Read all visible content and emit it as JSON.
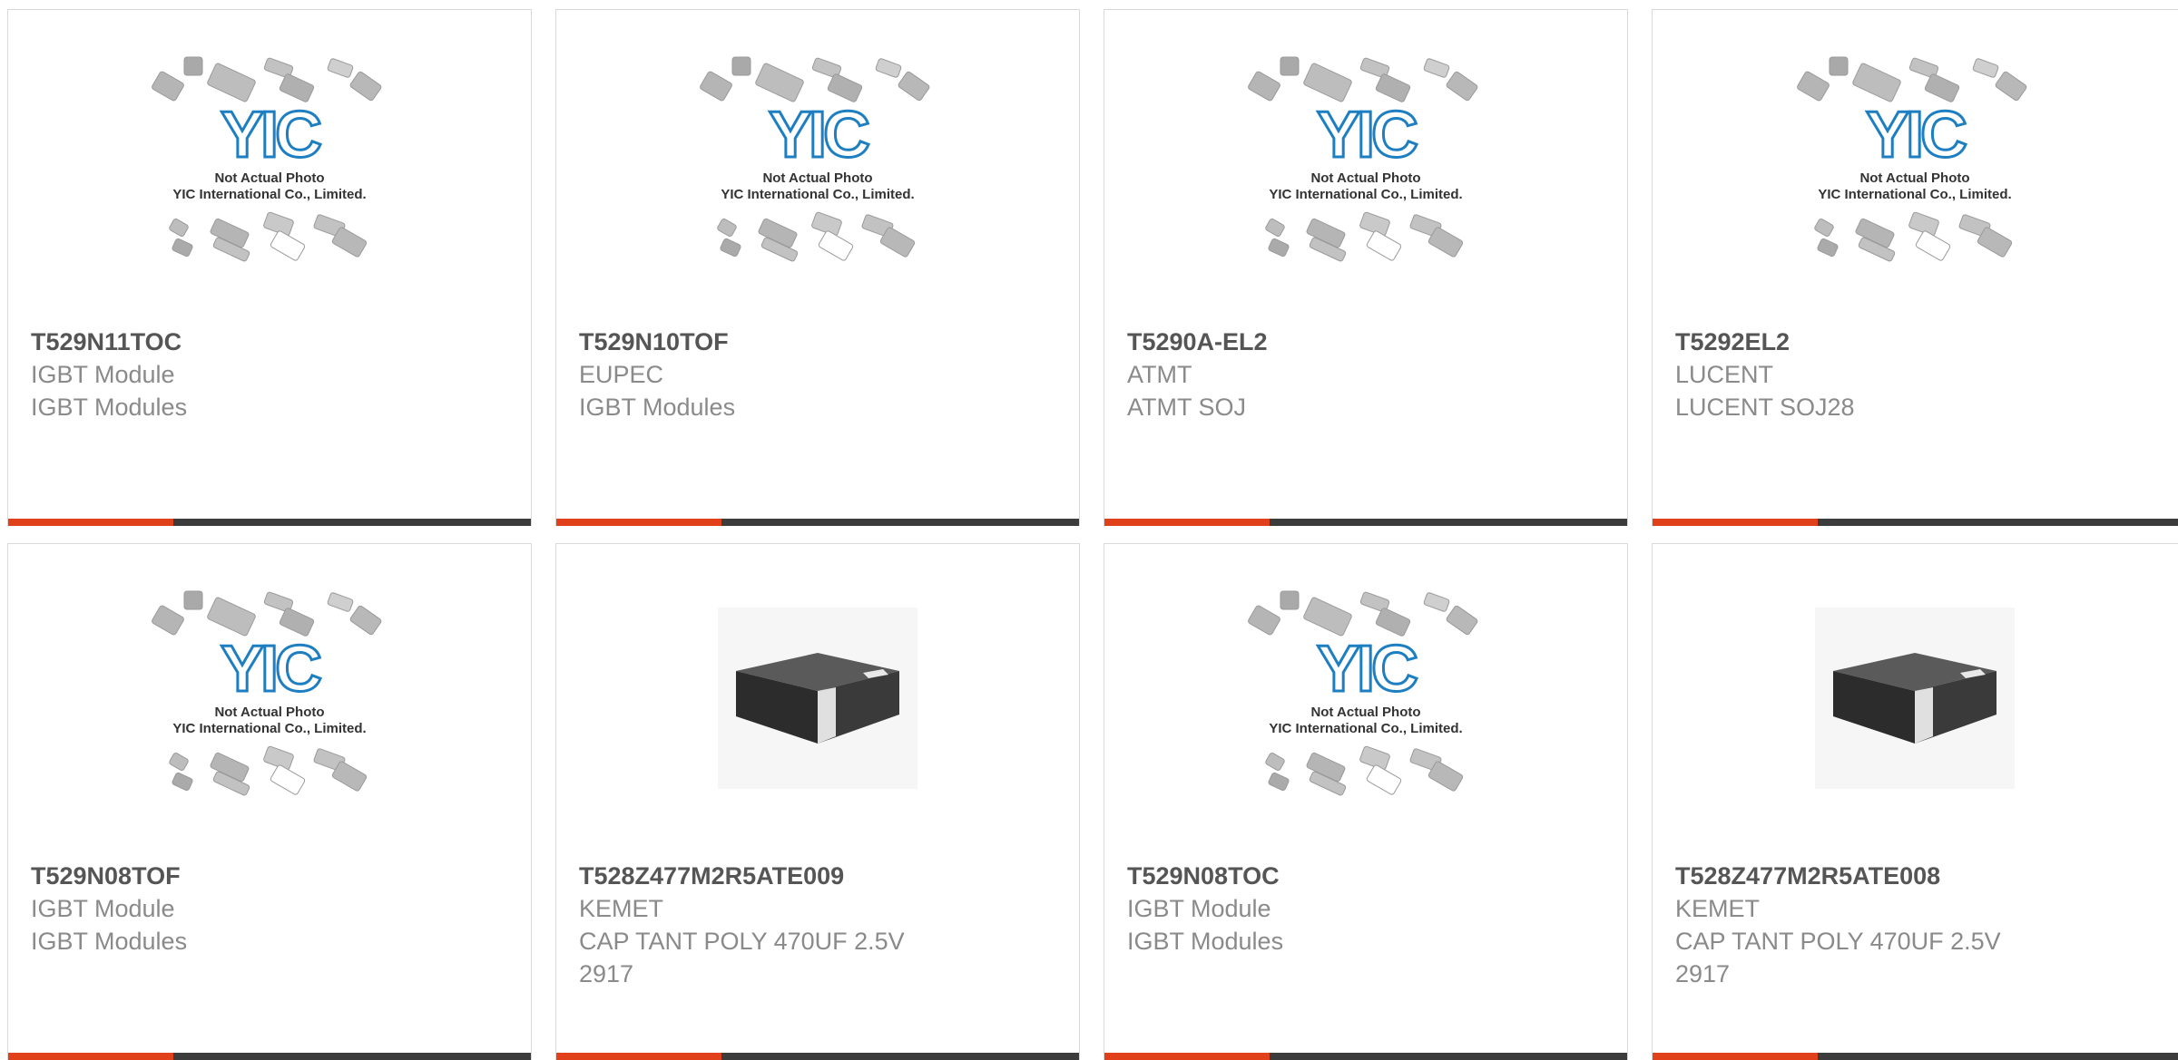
{
  "placeholder": {
    "logo_text": "YIC",
    "caption_line1": "Not Actual Photo",
    "caption_line2": "YIC International Co., Limited."
  },
  "colors": {
    "accent": "#e0401a",
    "bar": "#3c3c3c",
    "title": "#555555",
    "text": "#8a8a8a",
    "logo": "#1d7fc1"
  },
  "products": [
    {
      "part": "T529N11TOC",
      "line1": "IGBT Module",
      "line2": "IGBT Modules",
      "line3": "",
      "image": "not-actual-photo"
    },
    {
      "part": "T529N10TOF",
      "line1": "EUPEC",
      "line2": "IGBT Modules",
      "line3": "",
      "image": "not-actual-photo"
    },
    {
      "part": "T5290A-EL2",
      "line1": "ATMT",
      "line2": "ATMT SOJ",
      "line3": "",
      "image": "not-actual-photo"
    },
    {
      "part": "T5292EL2",
      "line1": "LUCENT",
      "line2": "LUCENT SOJ28",
      "line3": "",
      "image": "not-actual-photo"
    },
    {
      "part": "T529N08TOF",
      "line1": "IGBT Module",
      "line2": "IGBT Modules",
      "line3": "",
      "image": "not-actual-photo"
    },
    {
      "part": "T528Z477M2R5ATE009",
      "line1": "KEMET",
      "line2": "CAP TANT POLY 470UF 2.5V",
      "line3": "2917",
      "image": "capacitor"
    },
    {
      "part": "T529N08TOC",
      "line1": "IGBT Module",
      "line2": "IGBT Modules",
      "line3": "",
      "image": "not-actual-photo"
    },
    {
      "part": "T528Z477M2R5ATE008",
      "line1": "KEMET",
      "line2": "CAP TANT POLY 470UF 2.5V",
      "line3": "2917",
      "image": "capacitor"
    }
  ]
}
